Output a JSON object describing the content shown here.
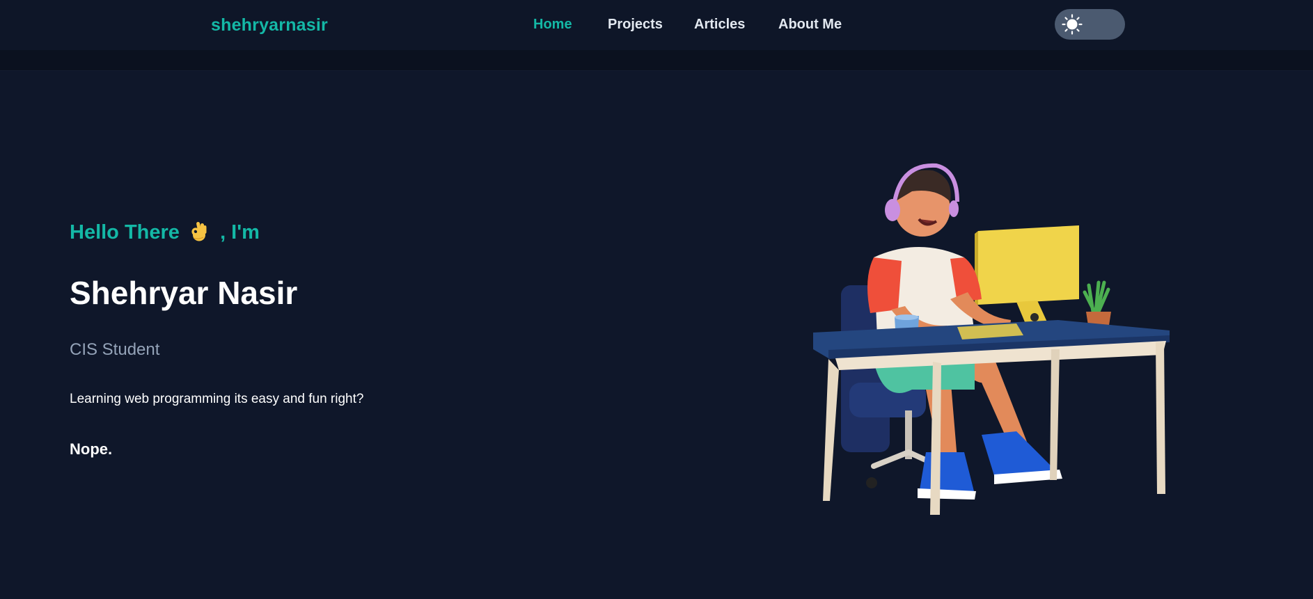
{
  "header": {
    "brand": "shehryarnasir",
    "nav": [
      {
        "label": "Home",
        "active": true
      },
      {
        "label": "Projects",
        "active": false
      },
      {
        "label": "Articles",
        "active": false
      },
      {
        "label": "About Me",
        "active": false
      }
    ],
    "theme_toggle": {
      "icon": "sun-icon",
      "state": "dark"
    }
  },
  "hero": {
    "greeting_pre": "Hello There",
    "greeting_emoji": "ok-hand-icon",
    "greeting_post": ", I'm",
    "name": "Shehryar Nasir",
    "role": "CIS Student",
    "tagline": "Learning web programming its easy and fun right?",
    "punchline": "Nope."
  },
  "colors": {
    "background": "#0f172a",
    "accent": "#14b8a6",
    "nav_text": "#e2e8f0",
    "muted": "#94a3b8",
    "toggle": "#4b5a70"
  }
}
